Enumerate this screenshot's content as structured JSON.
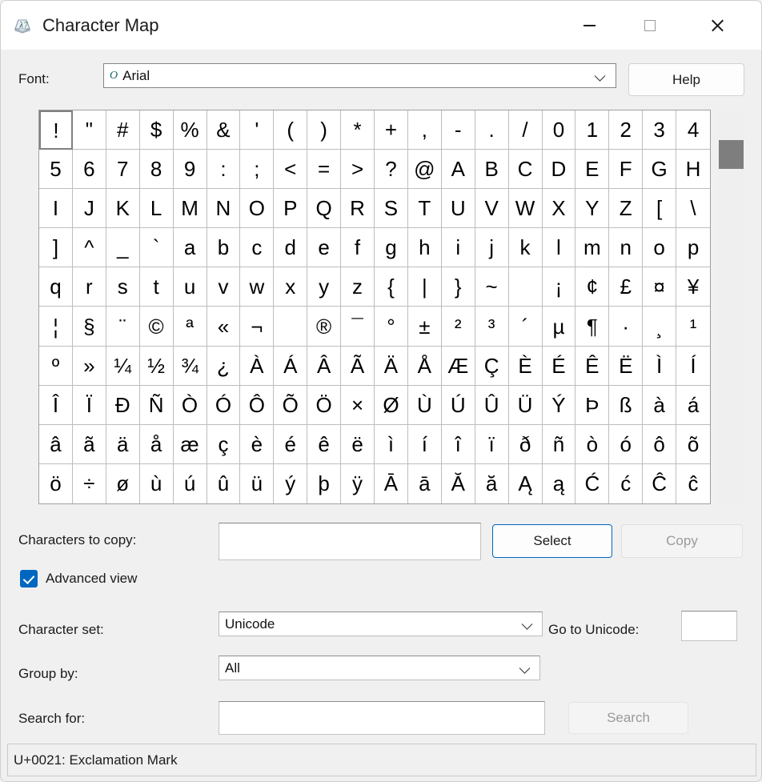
{
  "window": {
    "title": "Character Map",
    "icon": "charmap-icon",
    "caption": {
      "minimize": "minimize-icon",
      "maximize": "maximize-icon",
      "close": "close-icon"
    }
  },
  "font_row": {
    "label": "Font:",
    "value": "Arial",
    "type_icon": "O",
    "help_label": "Help"
  },
  "grid": {
    "selected_index": 0,
    "columns": 20,
    "rows": 10,
    "characters": [
      "!",
      "\"",
      "#",
      "$",
      "%",
      "&",
      "'",
      "(",
      ")",
      "*",
      "+",
      ",",
      "-",
      ".",
      "/",
      "0",
      "1",
      "2",
      "3",
      "4",
      "5",
      "6",
      "7",
      "8",
      "9",
      ":",
      ";",
      "<",
      "=",
      ">",
      "?",
      "@",
      "A",
      "B",
      "C",
      "D",
      "E",
      "F",
      "G",
      "H",
      "I",
      "J",
      "K",
      "L",
      "M",
      "N",
      "O",
      "P",
      "Q",
      "R",
      "S",
      "T",
      "U",
      "V",
      "W",
      "X",
      "Y",
      "Z",
      "[",
      "\\",
      "]",
      "^",
      "_",
      "`",
      "a",
      "b",
      "c",
      "d",
      "e",
      "f",
      "g",
      "h",
      "i",
      "j",
      "k",
      "l",
      "m",
      "n",
      "o",
      "p",
      "q",
      "r",
      "s",
      "t",
      "u",
      "v",
      "w",
      "x",
      "y",
      "z",
      "{",
      "|",
      "}",
      "~",
      " ",
      "¡",
      "¢",
      "£",
      "¤",
      "¥",
      "¦",
      "§",
      "¨",
      "©",
      "ª",
      "«",
      "¬",
      "­",
      "®",
      "¯",
      "°",
      "±",
      "²",
      "³",
      "´",
      "µ",
      "¶",
      "·",
      "¸",
      "¹",
      "º",
      "»",
      "¼",
      "½",
      "¾",
      "¿",
      "À",
      "Á",
      "Â",
      "Ã",
      "Ä",
      "Å",
      "Æ",
      "Ç",
      "È",
      "É",
      "Ê",
      "Ë",
      "Ì",
      "Í",
      "Î",
      "Ï",
      "Ð",
      "Ñ",
      "Ò",
      "Ó",
      "Ô",
      "Õ",
      "Ö",
      "×",
      "Ø",
      "Ù",
      "Ú",
      "Û",
      "Ü",
      "Ý",
      "Þ",
      "ß",
      "à",
      "á",
      "â",
      "ã",
      "ä",
      "å",
      "æ",
      "ç",
      "è",
      "é",
      "ê",
      "ë",
      "ì",
      "í",
      "î",
      "ï",
      "ð",
      "ñ",
      "ò",
      "ó",
      "ô",
      "õ",
      "ö",
      "÷",
      "ø",
      "ù",
      "ú",
      "û",
      "ü",
      "ý",
      "þ",
      "ÿ",
      "Ā",
      "ā",
      "Ă",
      "ă",
      "Ą",
      "ą",
      "Ć",
      "ć",
      "Ĉ",
      "ĉ"
    ]
  },
  "copy_row": {
    "label": "Characters to copy:",
    "value": "",
    "select_label": "Select",
    "copy_label": "Copy",
    "copy_enabled": false
  },
  "advanced": {
    "label": "Advanced view",
    "checked": true
  },
  "charset_row": {
    "label": "Character set:",
    "value": "Unicode",
    "goto_label": "Go to Unicode:",
    "goto_value": ""
  },
  "groupby_row": {
    "label": "Group by:",
    "value": "All"
  },
  "search_row": {
    "label": "Search for:",
    "value": "",
    "button_label": "Search",
    "button_enabled": false
  },
  "status": {
    "text": "U+0021: Exclamation Mark"
  },
  "colors": {
    "accent": "#0067c0",
    "window_bg": "#f0f0f0",
    "grid_bg": "#ffffff",
    "scroll_thumb": "#7e7e7e",
    "disabled_text": "#9a9a9a"
  }
}
